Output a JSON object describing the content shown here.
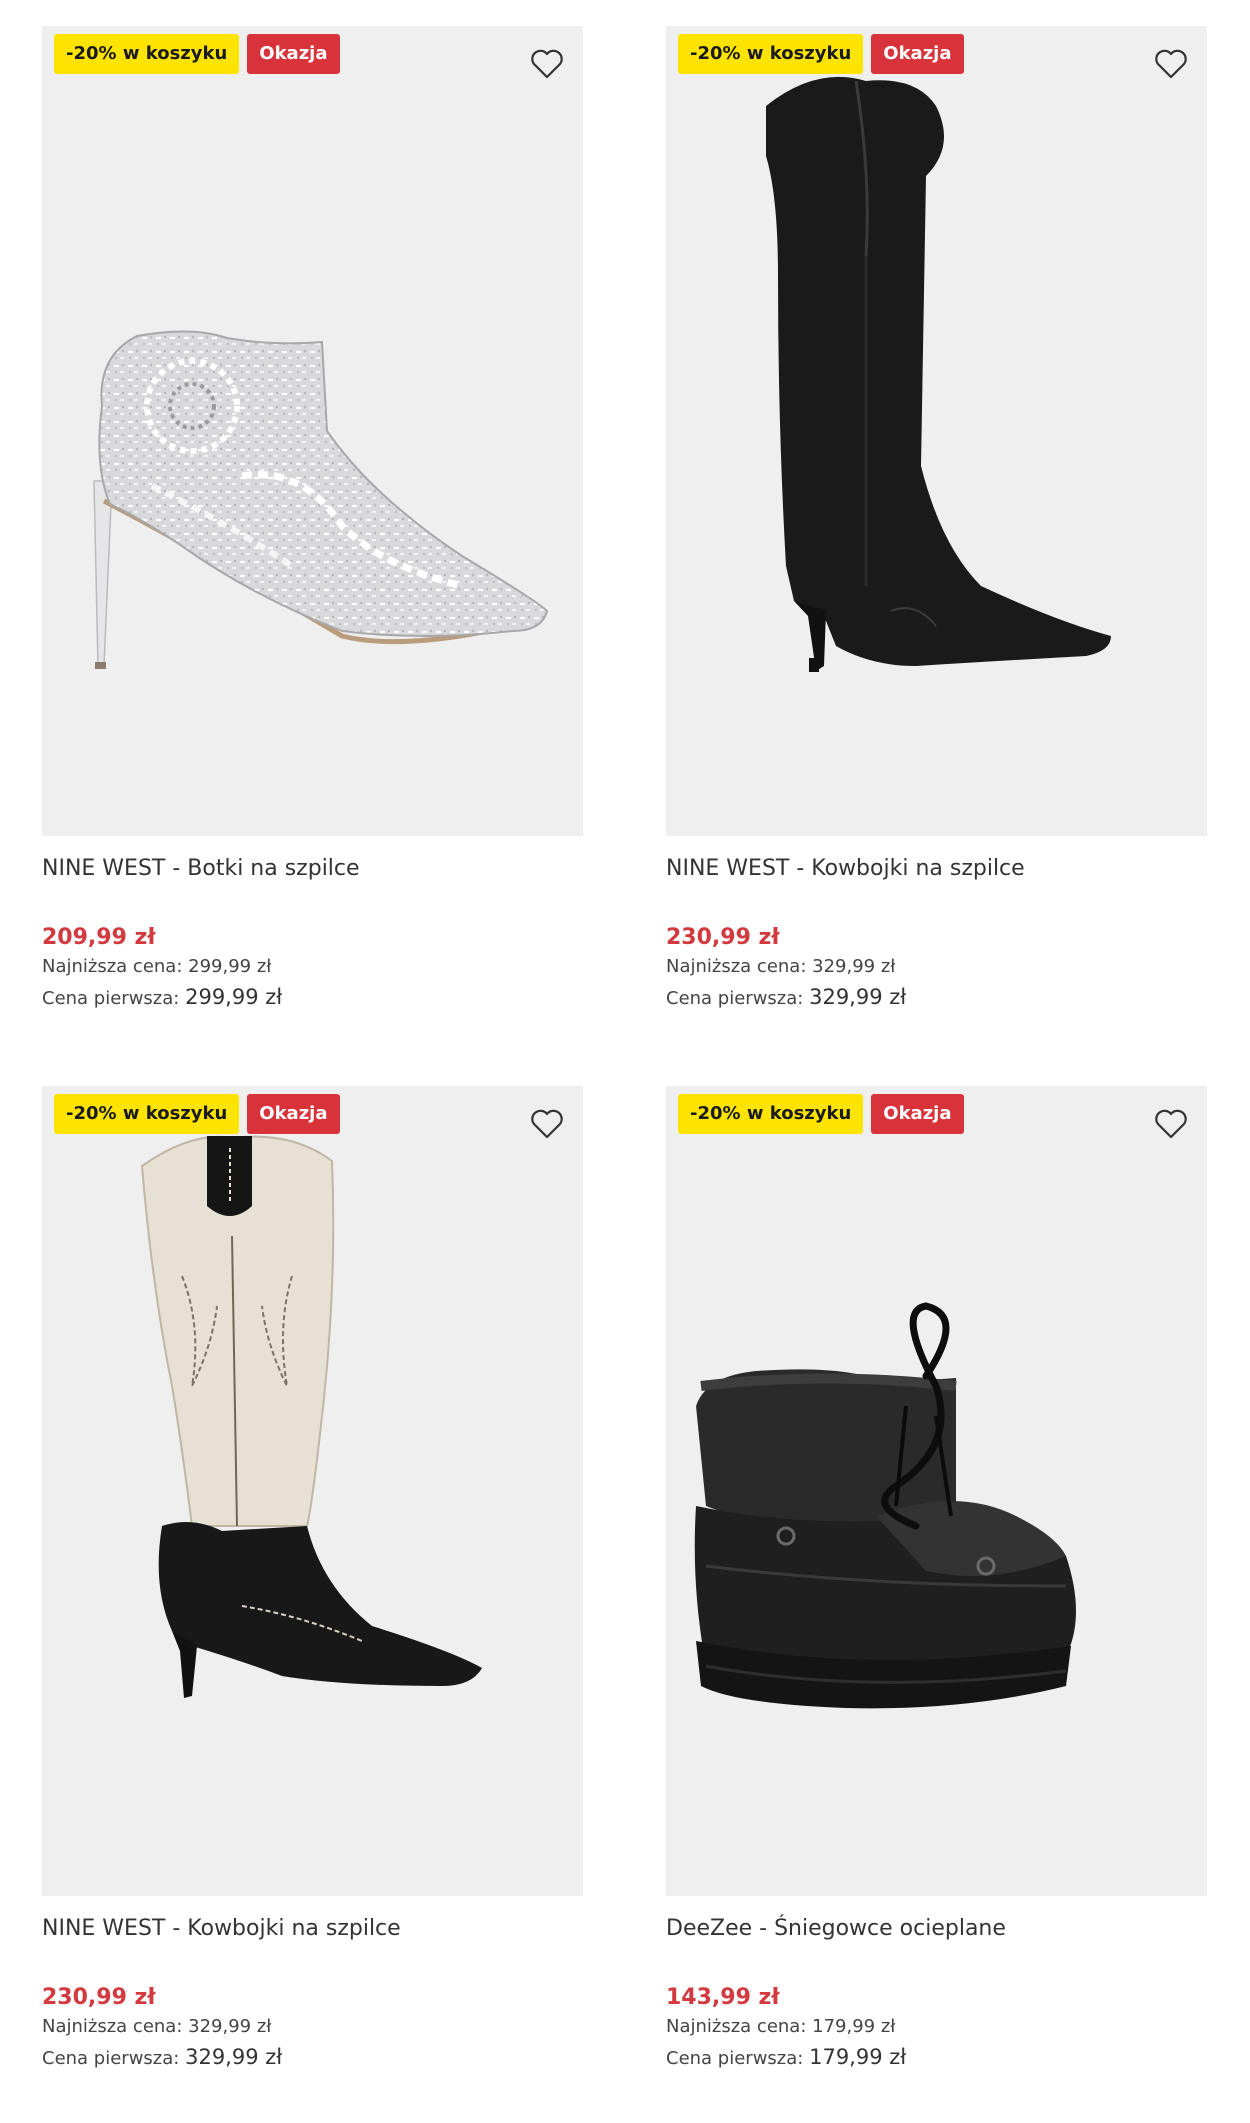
{
  "products": [
    {
      "badge_promo": "-20% w koszyku",
      "badge_deal": "Okazja",
      "title": "NINE WEST - Botki na szpilce",
      "price": "209,99 zł",
      "lowest_label": "Najniższa cena:",
      "lowest_value": "299,99 zł",
      "original_label": "Cena pierwsza:",
      "original_value": "299,99 zł",
      "wishlist_icon": "heart-outline-icon"
    },
    {
      "badge_promo": "-20% w koszyku",
      "badge_deal": "Okazja",
      "title": "NINE WEST - Kowbojki na szpilce",
      "price": "230,99 zł",
      "lowest_label": "Najniższa cena:",
      "lowest_value": "329,99 zł",
      "original_label": "Cena pierwsza:",
      "original_value": "329,99 zł",
      "wishlist_icon": "heart-outline-icon"
    },
    {
      "badge_promo": "-20% w koszyku",
      "badge_deal": "Okazja",
      "title": "NINE WEST - Kowbojki na szpilce",
      "price": "230,99 zł",
      "lowest_label": "Najniższa cena:",
      "lowest_value": "329,99 zł",
      "original_label": "Cena pierwsza:",
      "original_value": "329,99 zł",
      "wishlist_icon": "heart-outline-icon"
    },
    {
      "badge_promo": "-20% w koszyku",
      "badge_deal": "Okazja",
      "title": "DeeZee - Śniegowce ocieplane",
      "price": "143,99 zł",
      "lowest_label": "Najniższa cena:",
      "lowest_value": "179,99 zł",
      "original_label": "Cena pierwsza:",
      "original_value": "179,99 zł",
      "wishlist_icon": "heart-outline-icon"
    }
  ],
  "colors": {
    "promo_badge": "#fde300",
    "deal_badge": "#d8333b",
    "sale_price": "#d23a3f",
    "image_background": "#efefef"
  }
}
